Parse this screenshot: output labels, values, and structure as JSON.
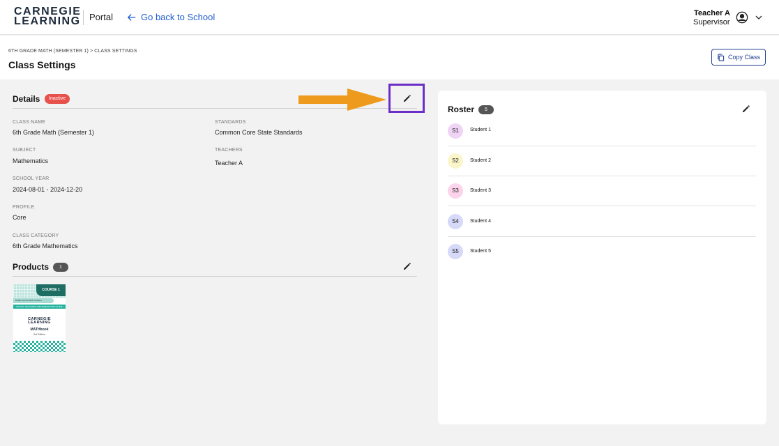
{
  "header": {
    "logo_line1": "CARNEGIE",
    "logo_line2": "LEARNING",
    "portal": "Portal",
    "back_link": "Go back to School",
    "user_name": "Teacher A",
    "user_role": "Supervisor"
  },
  "page": {
    "breadcrumb": "6TH GRADE MATH (SEMESTER 1) > CLASS SETTINGS",
    "title": "Class Settings",
    "copy_button": "Copy Class"
  },
  "details": {
    "title": "Details",
    "status": "Inactive",
    "fields": {
      "class_name": {
        "label": "CLASS NAME",
        "value": "6th Grade Math (Semester 1)"
      },
      "standards": {
        "label": "STANDARDS",
        "value": "Common Core State Standards"
      },
      "subject": {
        "label": "SUBJECT",
        "value": "Mathematics"
      },
      "teachers": {
        "label": "TEACHERS",
        "value": "Teacher A"
      },
      "school_year": {
        "label": "SCHOOL YEAR",
        "value": "2024-08-01 - 2024-12-20"
      },
      "profile": {
        "label": "PROFILE",
        "value": "Core"
      },
      "class_category": {
        "label": "CLASS CATEGORY",
        "value": "6th Grade Mathematics"
      }
    }
  },
  "products": {
    "title": "Products",
    "count": "1",
    "items": [
      {
        "course": "COURSE 1",
        "subtitle": "Middle School Math Solution",
        "band": "DIGITAL TEACHER'S IMPLEMENTATION GUIDE",
        "logo_line1": "CARNEGIE",
        "logo_line2": "LEARNING",
        "book": "MATHbook",
        "edition": "3rd Edition"
      }
    ]
  },
  "roster": {
    "title": "Roster",
    "count": "5",
    "students": [
      {
        "initials": "S1",
        "name": "Student 1",
        "color": "#f0d4f5"
      },
      {
        "initials": "S2",
        "name": "Student 2",
        "color": "#fbf5c9"
      },
      {
        "initials": "S3",
        "name": "Student 3",
        "color": "#fbd3ea"
      },
      {
        "initials": "S4",
        "name": "Student 4",
        "color": "#d7d9f8"
      },
      {
        "initials": "S5",
        "name": "Student 5",
        "color": "#d7d9f8"
      }
    ]
  },
  "colors": {
    "accent": "#1f5fd1",
    "highlight": "#6b2fc7",
    "arrow": "#ee9a1c",
    "inactive": "#e8504c"
  },
  "icons": [
    "arrow-left-icon",
    "user-circle-icon",
    "chevron-down-icon",
    "copy-icon",
    "pencil-icon",
    "arrow-right-icon"
  ]
}
